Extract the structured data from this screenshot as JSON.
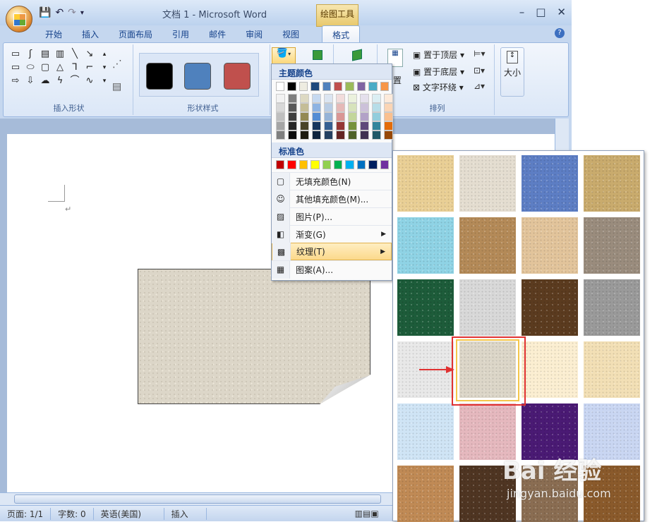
{
  "window": {
    "title": "文档 1 - Microsoft Word",
    "context_tab_group": "绘图工具",
    "buttons": {
      "minimize": "–",
      "maximize": "□",
      "close": "✕"
    },
    "help": "?"
  },
  "tabs": [
    {
      "label": "开始"
    },
    {
      "label": "插入"
    },
    {
      "label": "页面布局"
    },
    {
      "label": "引用"
    },
    {
      "label": "邮件"
    },
    {
      "label": "审阅"
    },
    {
      "label": "视图"
    },
    {
      "label": "格式",
      "active": true
    }
  ],
  "ribbon": {
    "groups": {
      "insert_shapes": "插入形状",
      "shape_styles": "形状样式",
      "arrange": "排列"
    },
    "arrange_items": {
      "bring_front": "置于顶层",
      "send_back": "置于底层",
      "text_wrap": "文字环绕",
      "position_fragment": "置"
    },
    "size_label": "大小",
    "style_swatches": [
      "#000000",
      "#4f81bd",
      "#c0504d"
    ]
  },
  "color_menu": {
    "theme_header": "主题颜色",
    "standard_header": "标准色",
    "theme_top": [
      "#ffffff",
      "#000000",
      "#eeece1",
      "#1f497d",
      "#4f81bd",
      "#c0504d",
      "#9bbb59",
      "#8064a2",
      "#4bacc6",
      "#f79646"
    ],
    "theme_shades": [
      [
        "#f2f2f2",
        "#d8d8d8",
        "#bfbfbf",
        "#a5a5a5",
        "#7f7f7f"
      ],
      [
        "#7f7f7f",
        "#595959",
        "#3f3f3f",
        "#262626",
        "#0c0c0c"
      ],
      [
        "#ddd9c3",
        "#c4bd97",
        "#938953",
        "#494429",
        "#1d1b10"
      ],
      [
        "#c6d9f0",
        "#8db3e2",
        "#548dd4",
        "#17365d",
        "#0f243e"
      ],
      [
        "#dbe5f1",
        "#b8cce4",
        "#95b3d7",
        "#366092",
        "#244061"
      ],
      [
        "#f2dcdb",
        "#e5b9b7",
        "#d99694",
        "#953734",
        "#632423"
      ],
      [
        "#ebf1dd",
        "#d7e3bc",
        "#c3d69b",
        "#76923c",
        "#4f6128"
      ],
      [
        "#e5e0ec",
        "#ccc1d9",
        "#b2a2c7",
        "#5f497a",
        "#3f3151"
      ],
      [
        "#dbeef3",
        "#b7dde8",
        "#92cddc",
        "#31859b",
        "#205867"
      ],
      [
        "#fdeada",
        "#fbd5b5",
        "#fac08f",
        "#e36c09",
        "#974806"
      ]
    ],
    "standard": [
      "#c00000",
      "#ff0000",
      "#ffc000",
      "#ffff00",
      "#92d050",
      "#00b050",
      "#00b0f0",
      "#0070c0",
      "#002060",
      "#7030a0"
    ],
    "items": [
      {
        "label": "无填充颜色(N)",
        "icon": "no-fill-icon"
      },
      {
        "label": "其他填充颜色(M)...",
        "icon": "palette-icon"
      },
      {
        "label": "图片(P)...",
        "icon": "picture-icon"
      },
      {
        "label": "渐变(G)",
        "icon": "gradient-icon",
        "submenu": true
      },
      {
        "label": "纹理(T)",
        "icon": "texture-icon",
        "submenu": true,
        "highlighted": true
      },
      {
        "label": "图案(A)...",
        "icon": "pattern-icon"
      }
    ]
  },
  "texture_gallery": {
    "rows": 6,
    "cols": 4,
    "selected_index": 13,
    "textures": [
      "#e9cf95",
      "#e4ddd0",
      "#5d7ec4",
      "#c9ab6d",
      "#8fd3e5",
      "#b48a58",
      "#e2c49b",
      "#9a8c7d",
      "#1d5c3a",
      "#d8d8d8",
      "#5b3b1f",
      "#9a9a9a",
      "#e8e8e8",
      "#dcd6c8",
      "#fbeed1",
      "#f2dfb5",
      "#cfe4f5",
      "#e5b8be",
      "#4a1a74",
      "#c9d6f2",
      "#c08a55",
      "#4f3522",
      "#8a6d52",
      "#8a5a2b"
    ]
  },
  "status_bar": {
    "page": "页面: 1/1",
    "words": "字数: 0",
    "language": "英语(美国)",
    "mode": "插入"
  },
  "watermark": {
    "brand": "Bai  经验",
    "url": "jingyan.baidu.com"
  }
}
